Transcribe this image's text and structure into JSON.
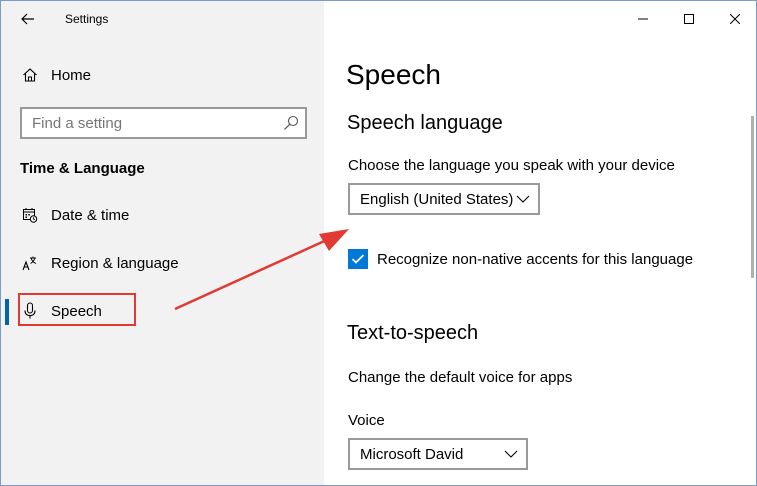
{
  "window": {
    "title": "Settings"
  },
  "sidebar": {
    "home_label": "Home",
    "search_placeholder": "Find a setting",
    "section_heading": "Time & Language",
    "items": [
      {
        "label": "Date & time",
        "icon": "calendar-clock-icon"
      },
      {
        "label": "Region & language",
        "icon": "language-icon"
      },
      {
        "label": "Speech",
        "icon": "microphone-icon",
        "selected": true
      }
    ]
  },
  "main": {
    "page_title": "Speech",
    "speech_language": {
      "heading": "Speech language",
      "description": "Choose the language you speak with your device",
      "selected_language": "English (United States)",
      "checkbox_label": "Recognize non-native accents for this language",
      "checkbox_checked": true
    },
    "text_to_speech": {
      "heading": "Text-to-speech",
      "description": "Change the default voice for apps",
      "voice_label": "Voice",
      "selected_voice": "Microsoft David"
    }
  },
  "colors": {
    "accent": "#0078d7",
    "selected_indicator": "#0063b1",
    "annotation_red": "#e03a33",
    "sidebar_bg": "#f2f2f2"
  }
}
